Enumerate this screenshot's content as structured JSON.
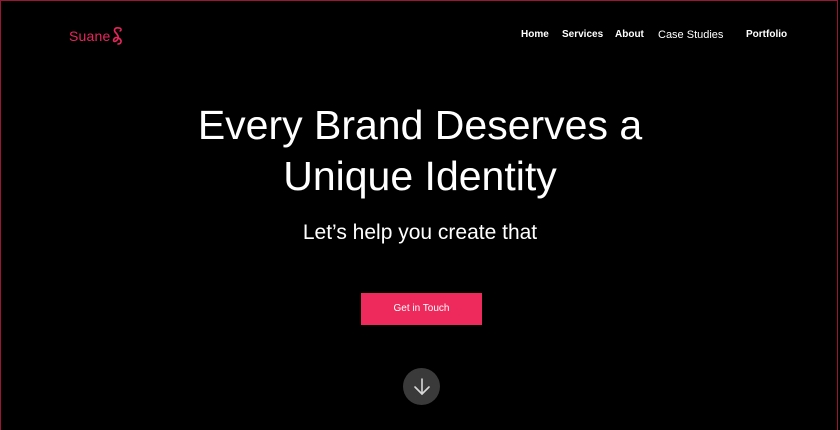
{
  "brand": {
    "name": "Suane",
    "accent_color": "#e8265e"
  },
  "nav": {
    "items": [
      {
        "label": "Home"
      },
      {
        "label": "Services"
      },
      {
        "label": "About"
      },
      {
        "label": "Case Studies"
      },
      {
        "label": "Portfolio"
      }
    ]
  },
  "hero": {
    "title_line1": "Every Brand Deserves a",
    "title_line2": "Unique Identity",
    "subtitle": "Let’s help you create that",
    "cta_label": "Get in Touch",
    "cta_color": "#ee2a5c",
    "scroll_icon": "arrow-down-icon"
  }
}
